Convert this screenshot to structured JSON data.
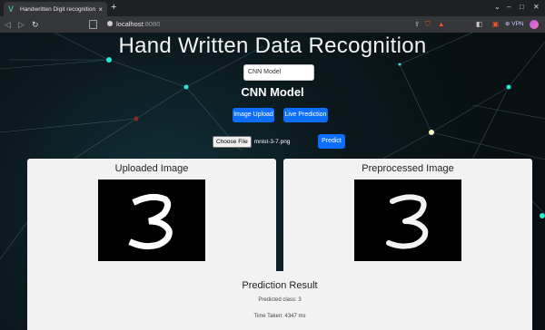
{
  "browser": {
    "tab_title": "Handwritten Digit recognition",
    "tab_close": "×",
    "new_tab": "+",
    "url_host": "localhost",
    "url_port": ":8080",
    "vpn_label": "VPN",
    "icons": [
      "vue-logo-icon",
      "back-icon",
      "forward-icon",
      "reload-icon",
      "bookmark-icon",
      "lock-icon",
      "share-icon",
      "brave-shield-icon",
      "rewards-icon",
      "sidebar-icon",
      "wallet-icon",
      "avatar-icon",
      "minimize-icon",
      "maximize-icon",
      "close-icon"
    ]
  },
  "page": {
    "heading": "Hand Written Data Recognition",
    "model_select_value": "CNN Model",
    "model_title": "CNN Model",
    "image_upload_label": "Image Upload",
    "live_prediction_label": "Live Prediction",
    "choose_file_label": "Choose File",
    "file_name": "mnist-3-7.png",
    "predict_label": "Predict",
    "uploaded_title": "Uploaded Image",
    "preprocessed_title": "Preprocessed Image",
    "result_title": "Prediction Result",
    "predicted_class": "Predicted class: 3",
    "time_taken": "Time Taken: 4347 ms"
  },
  "colors": {
    "primary_button": "#0d6efd",
    "card_bg": "#f2f2f2",
    "page_bg": "#0b1a1f",
    "network_node": "#2ee6d6"
  }
}
